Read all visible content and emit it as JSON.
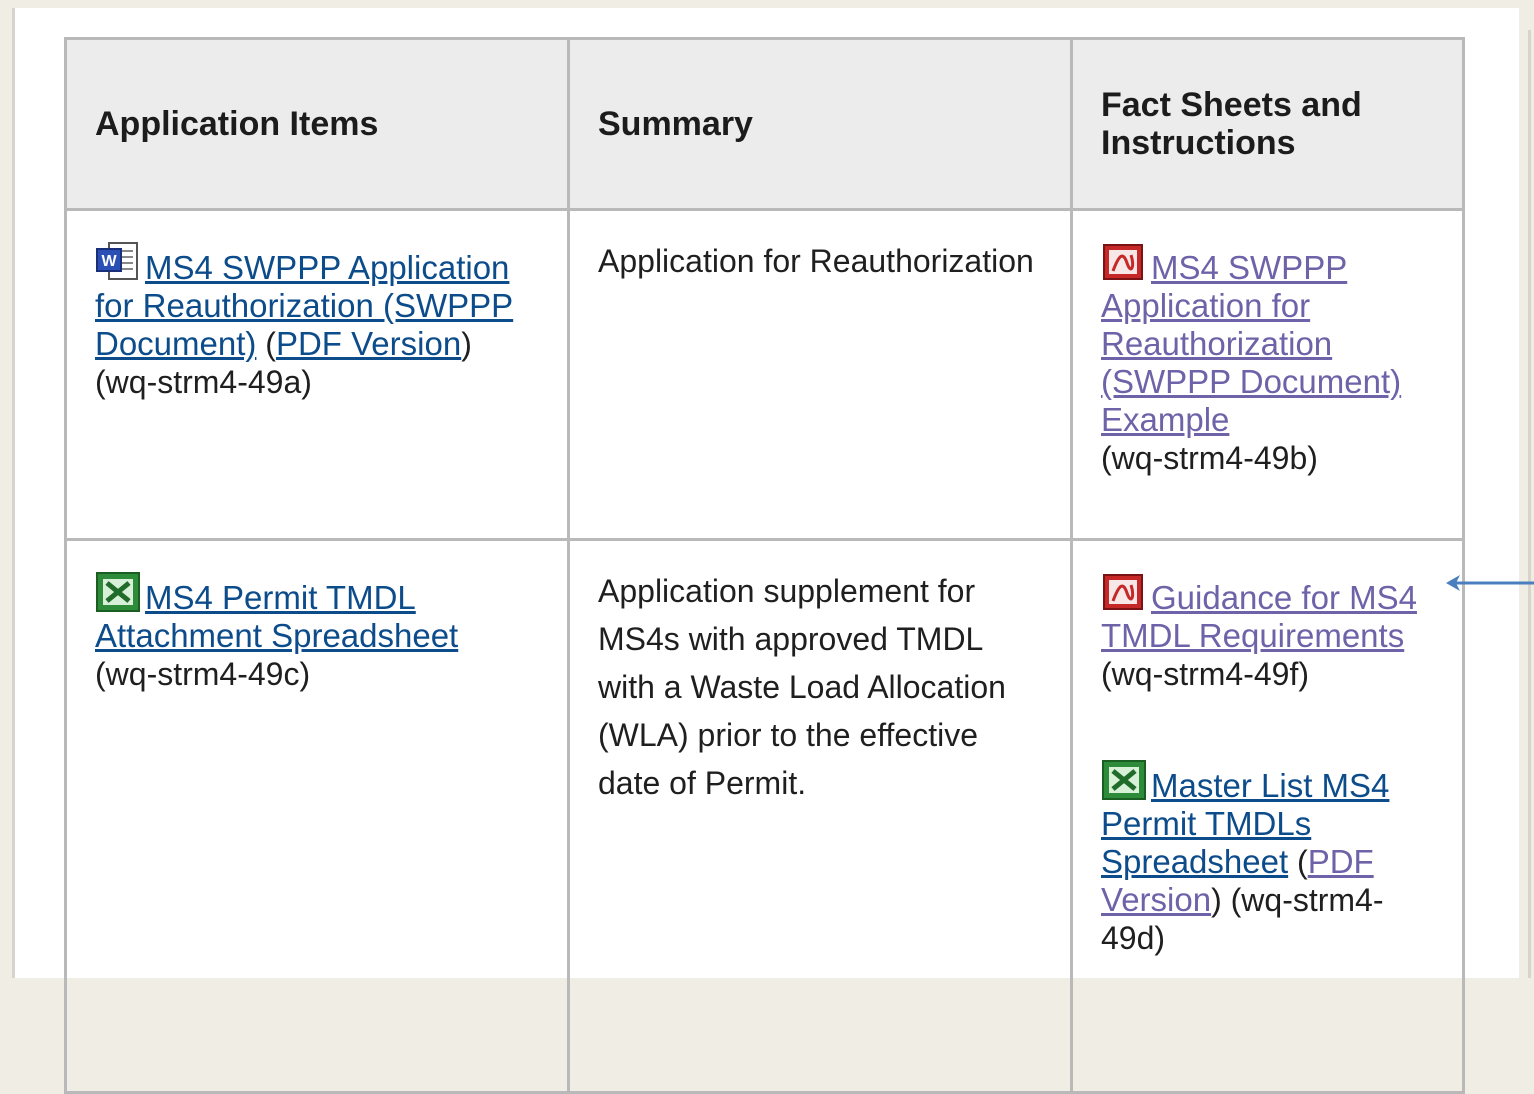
{
  "table": {
    "headers": [
      "Application Items",
      "Summary",
      "Fact Sheets and Instructions"
    ],
    "rows": [
      {
        "item": {
          "icon": "word-document-icon",
          "link": "MS4 SWPPP Application for Reauthorization (SWPPP Document)",
          "alt_open": " (",
          "alt_link": "PDF Version",
          "alt_close": ")",
          "code": "(wq-strm4-49a)"
        },
        "summary": "Application for Reauthorization",
        "facts": [
          {
            "icon": "pdf-icon",
            "link": "MS4 SWPPP Application for Reauthorization (SWPPP Document) Example",
            "code": "(wq-strm4-49b)"
          }
        ]
      },
      {
        "item": {
          "icon": "excel-spreadsheet-icon",
          "link": "MS4 Permit TMDL Attachment Spreadsheet",
          "code": "(wq-strm4-49c)"
        },
        "summary": "Application supplement for MS4s with approved TMDL with a Waste Load Allocation (WLA) prior to the effective date of Permit.",
        "facts": [
          {
            "icon": "pdf-icon",
            "link": "Guidance for MS4 TMDL Requirements",
            "code": "(wq-strm4-49f)"
          },
          {
            "icon": "excel-spreadsheet-icon",
            "link": "Master List MS4 Permit TMDLs Spreadsheet",
            "alt_open": " (",
            "alt_link": "PDF Version",
            "alt_close": ")",
            "code": " (wq-strm4-49d)"
          }
        ]
      }
    ]
  },
  "annotation": {
    "icon": "left-arrow-icon",
    "color": "#4a7fbf"
  },
  "colors": {
    "link": "#0d4c8b",
    "visited_link": "#6e63a8",
    "header_bg": "#ececec",
    "border": "#b9b9b9"
  }
}
